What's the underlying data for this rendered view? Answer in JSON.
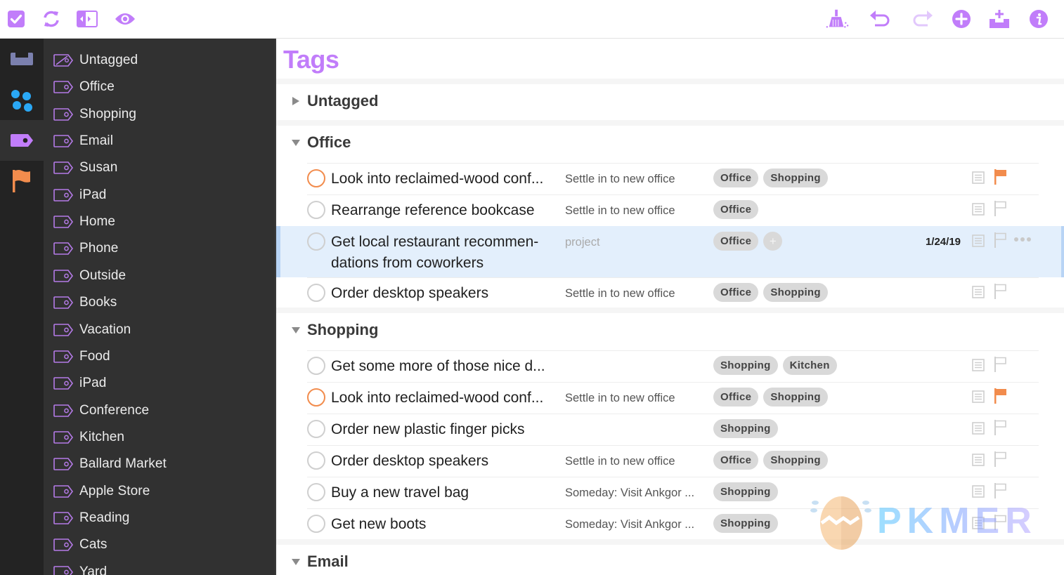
{
  "toolbar": {
    "left_buttons": [
      {
        "name": "check-app-icon",
        "label": "Completed"
      },
      {
        "name": "sync-icon",
        "label": "Sync"
      },
      {
        "name": "sidebar-toggle-icon",
        "label": "Toggle Sidebar"
      },
      {
        "name": "view-options-icon",
        "label": "View"
      }
    ],
    "right_buttons": [
      {
        "name": "clean-up-icon",
        "label": "Clean Up"
      },
      {
        "name": "undo-icon",
        "label": "Undo"
      },
      {
        "name": "redo-icon",
        "label": "Redo"
      },
      {
        "name": "add-icon",
        "label": "New Item"
      },
      {
        "name": "inbox-add-icon",
        "label": "Quick Entry"
      },
      {
        "name": "info-icon",
        "label": "Inspector"
      }
    ]
  },
  "rail": {
    "items": [
      {
        "name": "inbox",
        "icon": "inbox-icon",
        "selected": false
      },
      {
        "name": "projects",
        "icon": "projects-icon",
        "selected": false
      },
      {
        "name": "tags",
        "icon": "tag-icon",
        "selected": true
      },
      {
        "name": "flagged",
        "icon": "flag-icon",
        "selected": false
      }
    ]
  },
  "sidebar": {
    "items": [
      {
        "label": "Untagged",
        "icon": "untagged-icon"
      },
      {
        "label": "Office",
        "icon": "tag-outline-icon"
      },
      {
        "label": "Shopping",
        "icon": "tag-outline-icon"
      },
      {
        "label": "Email",
        "icon": "tag-outline-icon"
      },
      {
        "label": "Susan",
        "icon": "tag-outline-icon"
      },
      {
        "label": "iPad",
        "icon": "tag-outline-icon"
      },
      {
        "label": "Home",
        "icon": "tag-outline-icon"
      },
      {
        "label": "Phone",
        "icon": "tag-outline-icon"
      },
      {
        "label": "Outside",
        "icon": "tag-outline-icon"
      },
      {
        "label": "Books",
        "icon": "tag-outline-icon"
      },
      {
        "label": "Vacation",
        "icon": "tag-outline-icon"
      },
      {
        "label": "Food",
        "icon": "tag-outline-icon"
      },
      {
        "label": "iPad",
        "icon": "tag-outline-icon"
      },
      {
        "label": "Conference",
        "icon": "tag-outline-icon"
      },
      {
        "label": "Kitchen",
        "icon": "tag-outline-icon"
      },
      {
        "label": "Ballard Market",
        "icon": "tag-outline-icon"
      },
      {
        "label": "Apple Store",
        "icon": "tag-outline-icon"
      },
      {
        "label": "Reading",
        "icon": "tag-outline-icon"
      },
      {
        "label": "Cats",
        "icon": "tag-outline-icon"
      },
      {
        "label": "Yard",
        "icon": "tag-outline-icon"
      }
    ]
  },
  "main": {
    "title": "Tags",
    "sections": [
      {
        "title": "Untagged",
        "expanded": false,
        "rows": []
      },
      {
        "title": "Office",
        "expanded": true,
        "rows": [
          {
            "title": "Look into reclaimed-wood conf...",
            "project": "Settle in to new office",
            "tags": [
              "Office",
              "Shopping"
            ],
            "flagged": true,
            "due": "",
            "selected": false
          },
          {
            "title": "Rearrange reference bookcase",
            "project": "Settle in to new office",
            "tags": [
              "Office"
            ],
            "flagged": false,
            "due": "",
            "selected": false
          },
          {
            "title": "Get local restaurant recommen-dations from coworkers",
            "project": "project",
            "project_placeholder": true,
            "tags": [
              "Office"
            ],
            "add_tag": "+",
            "flagged": false,
            "due": "1/24/19",
            "selected": true
          },
          {
            "title": "Order desktop speakers",
            "project": "Settle in to new office",
            "tags": [
              "Office",
              "Shopping"
            ],
            "flagged": false,
            "due": "",
            "selected": false
          }
        ]
      },
      {
        "title": "Shopping",
        "expanded": true,
        "rows": [
          {
            "title": "Get some more of those nice d...",
            "project": "",
            "tags": [
              "Shopping",
              "Kitchen"
            ],
            "flagged": false,
            "due": "",
            "selected": false
          },
          {
            "title": "Look into reclaimed-wood conf...",
            "project": "Settle in to new office",
            "tags": [
              "Office",
              "Shopping"
            ],
            "flagged": true,
            "due": "",
            "selected": false
          },
          {
            "title": "Order new plastic finger picks",
            "project": "",
            "tags": [
              "Shopping"
            ],
            "flagged": false,
            "due": "",
            "selected": false
          },
          {
            "title": "Order desktop speakers",
            "project": "Settle in to new office",
            "tags": [
              "Office",
              "Shopping"
            ],
            "flagged": false,
            "due": "",
            "selected": false
          },
          {
            "title": "Buy a new travel bag",
            "project": "Someday: Visit Ankgor ...",
            "tags": [
              "Shopping"
            ],
            "flagged": false,
            "due": "",
            "selected": false
          },
          {
            "title": "Get new boots",
            "project": "Someday: Visit Ankgor ...",
            "tags": [
              "Shopping"
            ],
            "flagged": false,
            "due": "",
            "selected": false
          }
        ]
      },
      {
        "title": "Email",
        "expanded": true,
        "rows": []
      }
    ]
  },
  "watermark": {
    "text": "PKMER"
  },
  "colors": {
    "accent": "#c17dfa",
    "flag": "#f28c4d",
    "projects_blue": "#2aa8f5",
    "inbox_slate": "#7b80ae",
    "selection": "#e3effc"
  }
}
